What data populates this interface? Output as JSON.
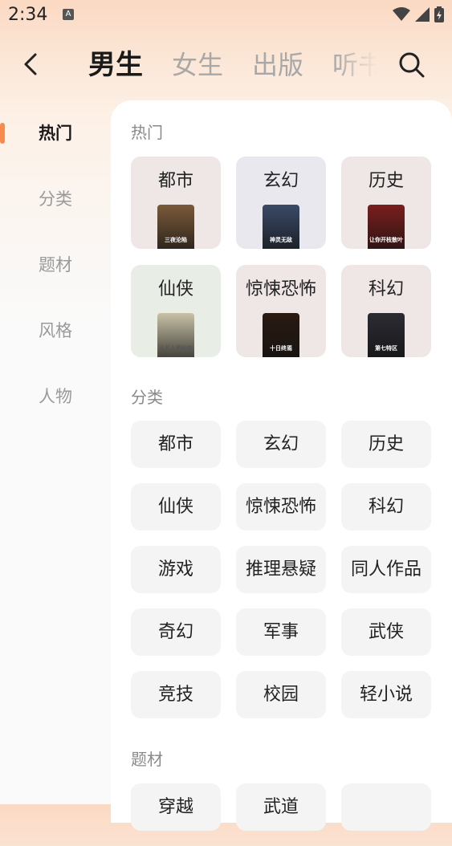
{
  "status_bar": {
    "time": "2:34",
    "notif_icon": "A"
  },
  "header": {
    "tabs": [
      {
        "label": "男生",
        "active": true
      },
      {
        "label": "女生",
        "active": false
      },
      {
        "label": "出版",
        "active": false
      },
      {
        "label": "听书",
        "active": false
      }
    ]
  },
  "sidebar": {
    "items": [
      {
        "label": "热门",
        "active": true
      },
      {
        "label": "分类",
        "active": false
      },
      {
        "label": "题材",
        "active": false
      },
      {
        "label": "风格",
        "active": false
      },
      {
        "label": "人物",
        "active": false
      }
    ]
  },
  "sections": {
    "hot": {
      "title": "热门",
      "cards": [
        {
          "label": "都市",
          "bg": "#eee7e6",
          "cover_color": "#7a5a3a",
          "cover_text": "三夜沦陷"
        },
        {
          "label": "玄幻",
          "bg": "#e8e8ee",
          "cover_color": "#3a4a66",
          "cover_text": "神灵无敌"
        },
        {
          "label": "历史",
          "bg": "#efe6e6",
          "cover_color": "#7a1e1e",
          "cover_text": "让你开枝散叶"
        },
        {
          "label": "仙侠",
          "bg": "#e8eee6",
          "cover_color": "#c9c2a8",
          "cover_text": "从凡人到仙帝"
        },
        {
          "label": "惊悚恐怖",
          "bg": "#efe6e6",
          "cover_color": "#2a1a12",
          "cover_text": "十日终焉"
        },
        {
          "label": "科幻",
          "bg": "#efe6e6",
          "cover_color": "#2b2b33",
          "cover_text": "第七特区"
        }
      ]
    },
    "category": {
      "title": "分类",
      "chips": [
        "都市",
        "玄幻",
        "历史",
        "仙侠",
        "惊悚恐怖",
        "科幻",
        "游戏",
        "推理悬疑",
        "同人作品",
        "奇幻",
        "军事",
        "武侠",
        "竞技",
        "校园",
        "轻小说"
      ]
    },
    "subject": {
      "title": "题材",
      "chips": [
        "穿越",
        "武道",
        ""
      ]
    }
  },
  "colors": {
    "accent": "#f68b4b",
    "chip_bg": "#f4f4f4"
  }
}
